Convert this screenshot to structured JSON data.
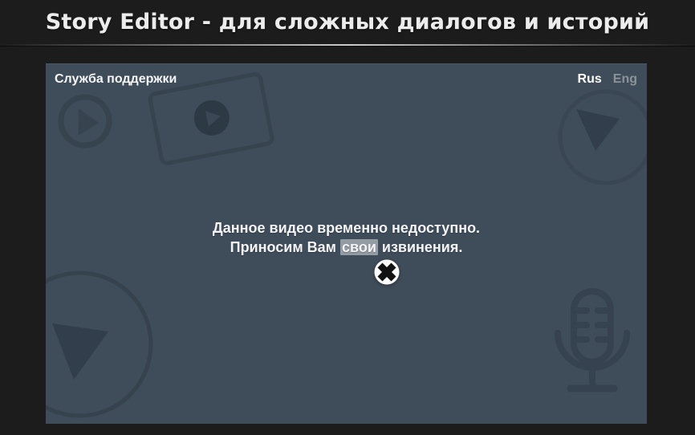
{
  "page": {
    "title": "Story Editor - для сложных диалогов и историй",
    "background_color": "#1c1c1c"
  },
  "panel": {
    "header": "Служба поддержки",
    "background_color": "#3f4c59",
    "language_switcher": {
      "options": [
        {
          "label": "Rus",
          "active": true
        },
        {
          "label": "Eng",
          "active": false
        }
      ],
      "active_color": "#ffffff",
      "inactive_color": "#8b9299"
    },
    "message": {
      "line1": "Данное видео временно недоступно.",
      "line2_before": "Приносим Вам ",
      "line2_highlighted": "свои",
      "line2_after": " извинения.",
      "text_color": "#f2f4f5",
      "highlight_color": "#939ba3"
    },
    "decorative_icons": [
      {
        "name": "play-circle-icon",
        "position": "top-left"
      },
      {
        "name": "video-player-icon",
        "position": "top-center"
      },
      {
        "name": "play-triangle-circle-icon",
        "position": "top-right"
      },
      {
        "name": "play-triangle-large-circle-icon",
        "position": "bottom-left"
      },
      {
        "name": "microphone-icon",
        "position": "bottom-right"
      }
    ],
    "decorative_icon_color": "#37434f",
    "busy_cursor": {
      "name": "busy-cursor-icon",
      "circle_color": "#ffffff",
      "cross_color": "#121212"
    }
  }
}
